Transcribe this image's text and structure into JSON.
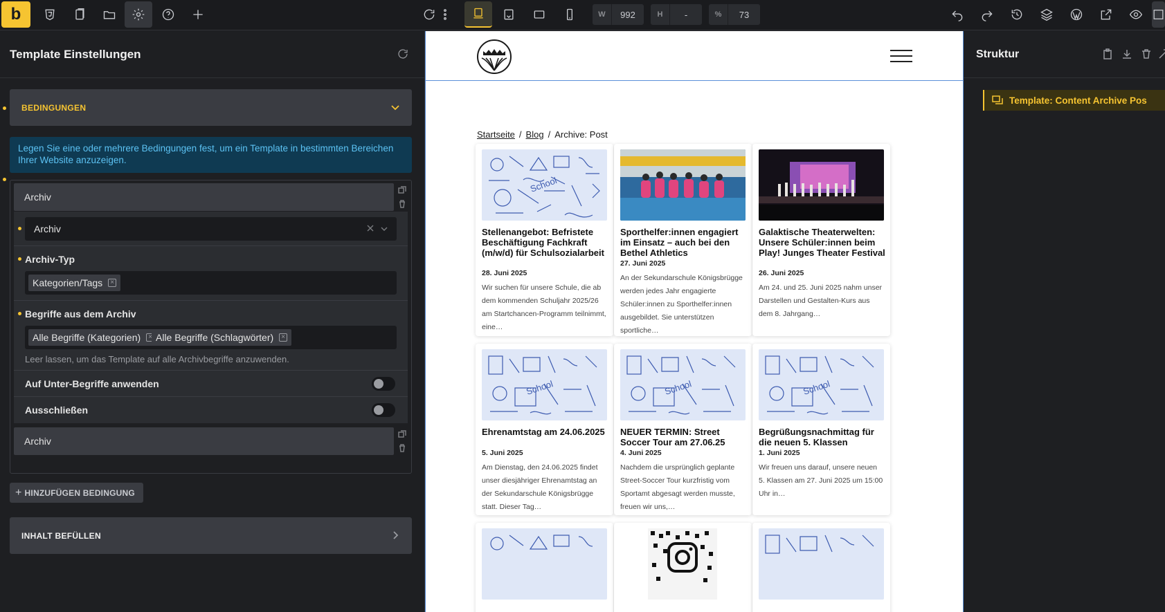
{
  "toolbar": {
    "logo": "b",
    "width_label": "W",
    "width_value": "992",
    "height_label": "H",
    "height_value": "-",
    "percent_label": "%",
    "percent_value": "73"
  },
  "left_panel": {
    "title": "Template Einstellungen",
    "conditions_header": "BEDINGUNGEN",
    "info_text": "Legen Sie eine oder mehrere Bedingungen fest, um ein Template in bestimmten Bereichen Ihrer Website anzuzeigen.",
    "condition1_title": "Archiv",
    "archive_select_value": "Archiv",
    "archive_type_label": "Archiv-Typ",
    "archive_type_tag": "Kategorien/Tags",
    "terms_label": "Begriffe aus dem Archiv",
    "terms_tags": [
      "Alle Begriffe (Kategorien)",
      "Alle Begriffe (Schlagwörter)"
    ],
    "terms_hint": "Leer lassen, um das Template auf alle Archivbegriffe anzuwenden.",
    "subterms_label": "Auf Unter-Begriffe anwenden",
    "exclude_label": "Ausschließen",
    "condition2_title": "Archiv",
    "add_condition_label": "HINZUFÜGEN BEDINGUNG",
    "fill_content_header": "INHALT BEFÜLLEN"
  },
  "canvas": {
    "breadcrumb": [
      "Startseite",
      "Blog",
      "Archive: Post"
    ],
    "cards": [
      {
        "title": "Stellenangebot: Befristete Beschäftigung Fachkraft (m/w/d) für Schulsozialarbeit",
        "date": "28. Juni 2025",
        "excerpt": "Wir suchen für unsere Schule, die ab dem kommenden Schuljahr 2025/26 am Startchancen-Programm teilnimmt, eine…"
      },
      {
        "title": "Sporthelfer:innen engagiert im Einsatz – auch bei den Bethel Athletics",
        "date": "27. Juni 2025",
        "excerpt": "An der Sekundarschule Königsbrügge werden jedes Jahr engagierte Schüler:innen zu Sporthelfer:innen ausgebildet. Sie unterstützen sportliche…"
      },
      {
        "title": "Galaktische Theaterwelten: Unsere Schüler:innen beim Play! Junges Theater Festival",
        "date": "26. Juni 2025",
        "excerpt": "Am 24. und 25. Juni 2025 nahm unser Darstellen und Gestalten-Kurs aus dem 8. Jahrgang…"
      },
      {
        "title": "Ehrenamtstag am 24.06.2025",
        "date": "5. Juni 2025",
        "excerpt": "Am Dienstag, den 24.06.2025 findet unser diesjähriger Ehrenamtstag an der Sekundarschule Königsbrügge statt. Dieser Tag…"
      },
      {
        "title": "NEUER TERMIN: Street Soccer Tour am 27.06.25",
        "date": "4. Juni 2025",
        "excerpt": "Nachdem die ursprünglich geplante Street-Soccer Tour kurzfristig vom Sportamt abgesagt werden musste, freuen wir uns,…"
      },
      {
        "title": "Begrüßungsnachmittag für die neuen 5. Klassen",
        "date": "1. Juni 2025",
        "excerpt": "Wir freuen uns darauf, unsere neuen 5. Klassen am 27. Juni 2025 um 15:00 Uhr in…"
      }
    ]
  },
  "right_panel": {
    "title": "Struktur",
    "tree_item": "Template: Content Archive Pos"
  },
  "colors": {
    "accent": "#f6c431",
    "info_bg": "#0f3a52",
    "info_text": "#5cc2f3",
    "canvas_outline": "#5b8fd9"
  }
}
